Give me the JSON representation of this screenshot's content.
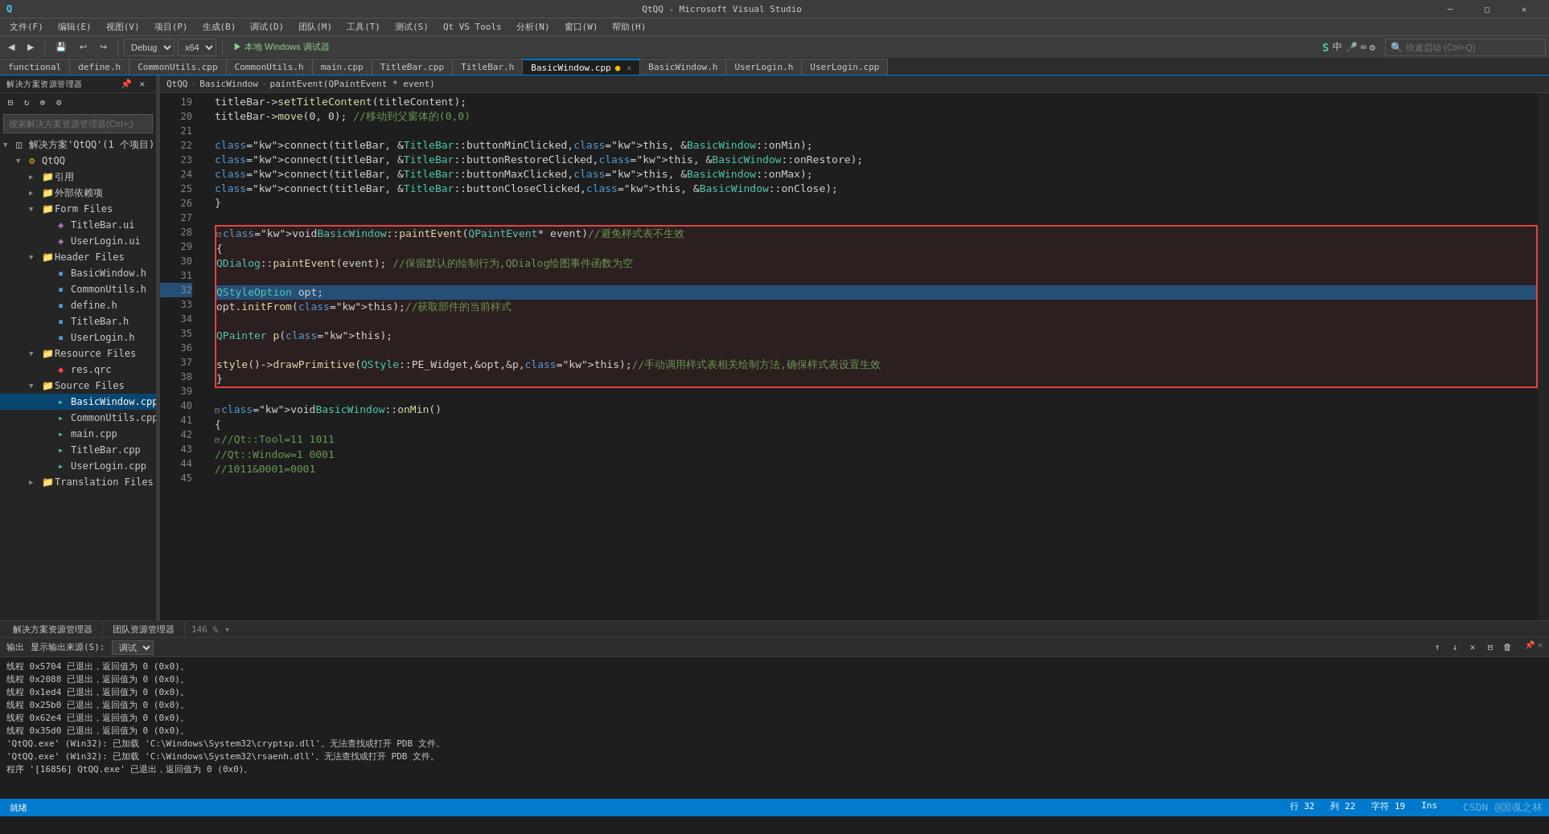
{
  "app": {
    "title": "QtQQ - Microsoft Visual Studio",
    "icon": "QtQQ"
  },
  "title_bar": {
    "title": "QtQQ - Microsoft Visual Studio",
    "min_label": "─",
    "max_label": "□",
    "close_label": "✕"
  },
  "menu": {
    "items": [
      "文件(F)",
      "编辑(E)",
      "视图(V)",
      "项目(P)",
      "生成(B)",
      "调试(D)",
      "团队(M)",
      "工具(T)",
      "测试(S)",
      "Qt VS Tools",
      "分析(N)",
      "窗口(W)",
      "帮助(H)"
    ]
  },
  "toolbar": {
    "debug_config": "Debug",
    "platform": "x64",
    "run_label": "▶ 本地 Windows 调试器",
    "search_placeholder": "快速启动 (Ctrl+Q)"
  },
  "tabs": [
    {
      "label": "functional",
      "active": false,
      "modified": false
    },
    {
      "label": "define.h",
      "active": false,
      "modified": false
    },
    {
      "label": "CommonUtils.cpp",
      "active": false,
      "modified": false
    },
    {
      "label": "CommonUtils.h",
      "active": false,
      "modified": false
    },
    {
      "label": "main.cpp",
      "active": false,
      "modified": false
    },
    {
      "label": "TitleBar.cpp",
      "active": false,
      "modified": false
    },
    {
      "label": "TitleBar.h",
      "active": false,
      "modified": false
    },
    {
      "label": "BasicWindow.cpp",
      "active": true,
      "modified": true
    },
    {
      "label": "BasicWindow.h",
      "active": false,
      "modified": false
    },
    {
      "label": "UserLogin.h",
      "active": false,
      "modified": false
    },
    {
      "label": "UserLogin.cpp",
      "active": false,
      "modified": false
    }
  ],
  "breadcrumb": {
    "parts": [
      "QtQQ",
      "BasicWindow",
      "paintEvent(QPaintEvent * event)"
    ]
  },
  "solution_explorer": {
    "title": "解决方案资源管理器",
    "search_placeholder": "搜索解决方案资源管理器(Ctrl+;)",
    "tree": [
      {
        "level": 0,
        "label": "解决方案'QtQQ'(1 个项目)",
        "type": "solution",
        "expanded": true
      },
      {
        "level": 1,
        "label": "QtQQ",
        "type": "project",
        "expanded": true
      },
      {
        "level": 2,
        "label": "引用",
        "type": "folder",
        "expanded": false
      },
      {
        "level": 2,
        "label": "外部依赖项",
        "type": "folder",
        "expanded": false
      },
      {
        "level": 2,
        "label": "Form Files",
        "type": "folder",
        "expanded": true
      },
      {
        "level": 3,
        "label": "TitleBar.ui",
        "type": "ui"
      },
      {
        "level": 3,
        "label": "UserLogin.ui",
        "type": "ui"
      },
      {
        "level": 2,
        "label": "Header Files",
        "type": "folder",
        "expanded": true
      },
      {
        "level": 3,
        "label": "BasicWindow.h",
        "type": "h"
      },
      {
        "level": 3,
        "label": "CommonUtils.h",
        "type": "h"
      },
      {
        "level": 3,
        "label": "define.h",
        "type": "h"
      },
      {
        "level": 3,
        "label": "TitleBar.h",
        "type": "h"
      },
      {
        "level": 3,
        "label": "UserLogin.h",
        "type": "h"
      },
      {
        "level": 2,
        "label": "Resource Files",
        "type": "folder",
        "expanded": true
      },
      {
        "level": 3,
        "label": "res.qrc",
        "type": "qrc"
      },
      {
        "level": 2,
        "label": "Source Files",
        "type": "folder",
        "expanded": true
      },
      {
        "level": 3,
        "label": "BasicWindow.cpp",
        "type": "cpp",
        "selected": true
      },
      {
        "level": 3,
        "label": "CommonUtils.cpp",
        "type": "cpp"
      },
      {
        "level": 3,
        "label": "main.cpp",
        "type": "cpp"
      },
      {
        "level": 3,
        "label": "TitleBar.cpp",
        "type": "cpp"
      },
      {
        "level": 3,
        "label": "UserLogin.cpp",
        "type": "cpp"
      },
      {
        "level": 2,
        "label": "Translation Files",
        "type": "folder",
        "expanded": false
      }
    ]
  },
  "code": {
    "lines": [
      {
        "num": 19,
        "content": "    titleBar->setTitleContent(titleContent);"
      },
      {
        "num": 20,
        "content": "    titleBar->move(0, 0);        //移动到父窗体的(0,0)"
      },
      {
        "num": 21,
        "content": ""
      },
      {
        "num": 22,
        "content": "    connect(titleBar, &TitleBar::buttonMinClicked, this, &BasicWindow::onMin);"
      },
      {
        "num": 23,
        "content": "    connect(titleBar, &TitleBar::buttonRestoreClicked, this, &BasicWindow::onRestore);"
      },
      {
        "num": 24,
        "content": "    connect(titleBar, &TitleBar::buttonMaxClicked, this, &BasicWindow::onMax);"
      },
      {
        "num": 25,
        "content": "    connect(titleBar, &TitleBar::buttonCloseClicked, this, &BasicWindow::onClose);"
      },
      {
        "num": 26,
        "content": "}"
      },
      {
        "num": 27,
        "content": ""
      },
      {
        "num": 28,
        "content": "void BasicWindow::paintEvent(QPaintEvent * event) //避免样式表不生效",
        "region_start": true
      },
      {
        "num": 29,
        "content": "{"
      },
      {
        "num": 30,
        "content": "    QDialog::paintEvent(event);       //保留默认的绘制行为,QDialog绘图事件函数为空"
      },
      {
        "num": 31,
        "content": ""
      },
      {
        "num": 32,
        "content": "    QStyleOption opt;",
        "selected": true
      },
      {
        "num": 33,
        "content": "    opt.initFrom(this);   //获取部件的当前样式"
      },
      {
        "num": 34,
        "content": ""
      },
      {
        "num": 35,
        "content": "    QPainter p(this);"
      },
      {
        "num": 36,
        "content": ""
      },
      {
        "num": 37,
        "content": "    style()->drawPrimitive(QStyle::PE_Widget,&opt,&p,this);      //手动调用样式表相关绘制方法,确保样式表设置生效"
      },
      {
        "num": 38,
        "content": "}",
        "region_end": true
      },
      {
        "num": 39,
        "content": ""
      },
      {
        "num": 40,
        "content": "void BasicWindow::onMin()",
        "fold": true
      },
      {
        "num": 41,
        "content": "{"
      },
      {
        "num": 42,
        "content": "    //Qt::Tool=11    1011",
        "fold_child": true
      },
      {
        "num": 43,
        "content": "    //Qt::Window=1   0001",
        "fold_child": true
      },
      {
        "num": 44,
        "content": "    //1011&0001=0001",
        "fold_child": true
      },
      {
        "num": 45,
        "content": ""
      }
    ]
  },
  "bottom_tabs": [
    {
      "label": "解决方案资源管理器",
      "active": false
    },
    {
      "label": "团队资源管理器",
      "active": false
    }
  ],
  "zoom": "146 %",
  "output": {
    "title": "输出",
    "show_label": "显示输出来源(S):",
    "source": "调试",
    "lines": [
      "线程 0x5704 已退出，返回值为 0 (0x0)。",
      "线程 0x2088 已退出，返回值为 0 (0x0)。",
      "线程 0x1ed4 已退出，返回值为 0 (0x0)。",
      "线程 0x25b0 已退出，返回值为 0 (0x0)。",
      "线程 0x62e4 已退出，返回值为 0 (0x0)。",
      "线程 0x35d0 已退出，返回值为 0 (0x0)。",
      "'QtQQ.exe' (Win32): 已加载 'C:\\Windows\\System32\\cryptsp.dll'。无法查找或打开 PDB 文件。",
      "'QtQQ.exe' (Win32): 已加载 'C:\\Windows\\System32\\rsaenh.dll'。无法查找或打开 PDB 文件。",
      "程序 '[16856] QtQQ.exe' 已退出，返回值为 0 (0x0)。"
    ]
  },
  "status_bar": {
    "left_text": "就绪",
    "row": "行 32",
    "col": "列 22",
    "char": "字符 19",
    "ins": "Ins",
    "zoom": "146 %"
  },
  "watermark": "CSDN @国魂之林"
}
